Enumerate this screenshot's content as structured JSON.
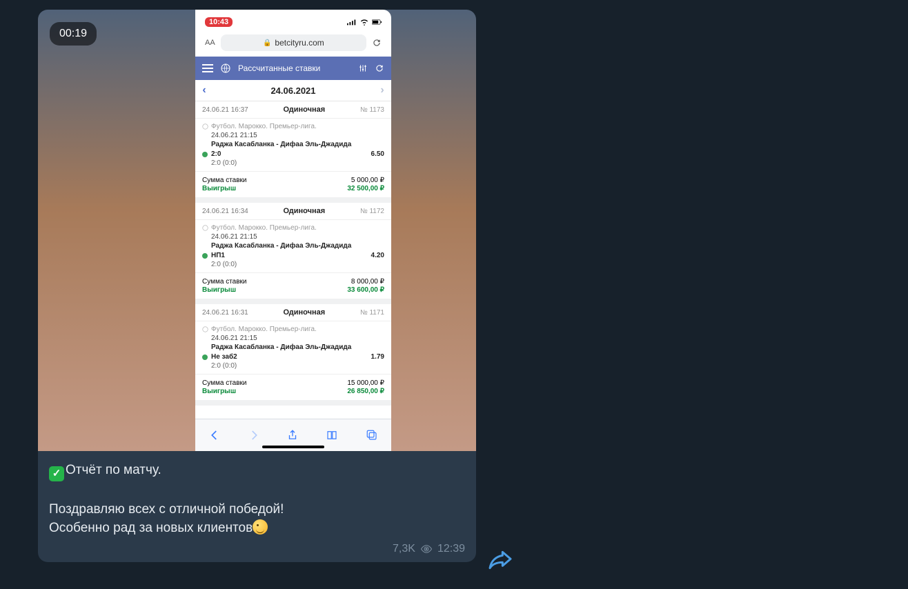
{
  "message": {
    "duration": "00:19",
    "text_line1_emoji": "✓",
    "text_line1": "Отчёт по матчу.",
    "text_line2": "Поздравляю всех с отличной победой!",
    "text_line3": "Особенно рад за новых клиентов",
    "views": "7,3K",
    "time": "12:39"
  },
  "phone": {
    "status_time": "10:43",
    "url_aa": "AA",
    "url": "betcityru.com",
    "appbar_title": "Рассчитанные ставки",
    "date": "24.06.2021"
  },
  "bets": [
    {
      "ts": "24.06.21 16:37",
      "type": "Одиночная",
      "num": "№ 1173",
      "league": "Футбол. Марокко. Премьер-лига.",
      "ev_time": "24.06.21 21:15",
      "match": "Раджа Касабланка - Дифаа Эль-Джадида",
      "pick": "2:0",
      "odd": "6.50",
      "score": "2:0 (0:0)",
      "stake_label": "Сумма ставки",
      "stake": "5 000,00 ₽",
      "win_label": "Выигрыш",
      "win": "32 500,00 ₽"
    },
    {
      "ts": "24.06.21 16:34",
      "type": "Одиночная",
      "num": "№ 1172",
      "league": "Футбол. Марокко. Премьер-лига.",
      "ev_time": "24.06.21 21:15",
      "match": "Раджа Касабланка - Дифаа Эль-Джадида",
      "pick": "НП1",
      "odd": "4.20",
      "score": "2:0 (0:0)",
      "stake_label": "Сумма ставки",
      "stake": "8 000,00 ₽",
      "win_label": "Выигрыш",
      "win": "33 600,00 ₽"
    },
    {
      "ts": "24.06.21 16:31",
      "type": "Одиночная",
      "num": "№ 1171",
      "league": "Футбол. Марокко. Премьер-лига.",
      "ev_time": "24.06.21 21:15",
      "match": "Раджа Касабланка - Дифаа Эль-Джадида",
      "pick": "Не заб2",
      "odd": "1.79",
      "score": "2:0 (0:0)",
      "stake_label": "Сумма ставки",
      "stake": "15 000,00 ₽",
      "win_label": "Выигрыш",
      "win": "26 850,00 ₽"
    }
  ]
}
